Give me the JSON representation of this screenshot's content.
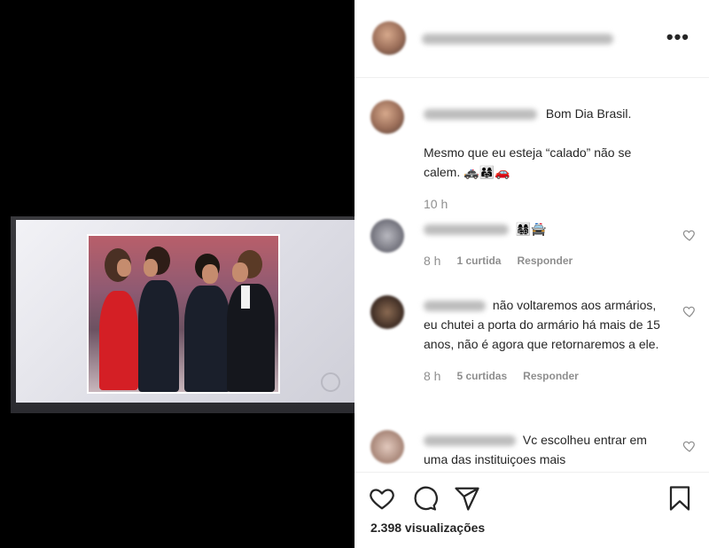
{
  "post": {
    "caption_greeting": "Bom Dia Brasil.",
    "caption_body": "Mesmo que eu esteja “calado” não se calem. 🚓👨‍👩‍👧🚗",
    "caption_time": "10 h",
    "views": "2.398 visualizações"
  },
  "header": {
    "more_icon": "more-options-icon",
    "more_label": "•••"
  },
  "comments": [
    {
      "text": "👩‍👩‍👧‍👦🚔",
      "time": "8 h",
      "likes": "1 curtida",
      "reply": "Responder"
    },
    {
      "text": "não voltaremos aos armários, eu chutei a porta do armário há mais de 15 anos, não é agora que retornaremos a ele.",
      "time": "8 h",
      "likes": "5 curtidas",
      "reply": "Responder"
    },
    {
      "text": "Vc escolheu entrar em uma das instituiçoes mais"
    }
  ],
  "icons": {
    "like": "heart-icon",
    "comment": "comment-icon",
    "share": "send-icon",
    "save": "bookmark-icon"
  },
  "colors": {
    "text": "#262626",
    "muted": "#8e8e8e",
    "border": "#efefef"
  }
}
